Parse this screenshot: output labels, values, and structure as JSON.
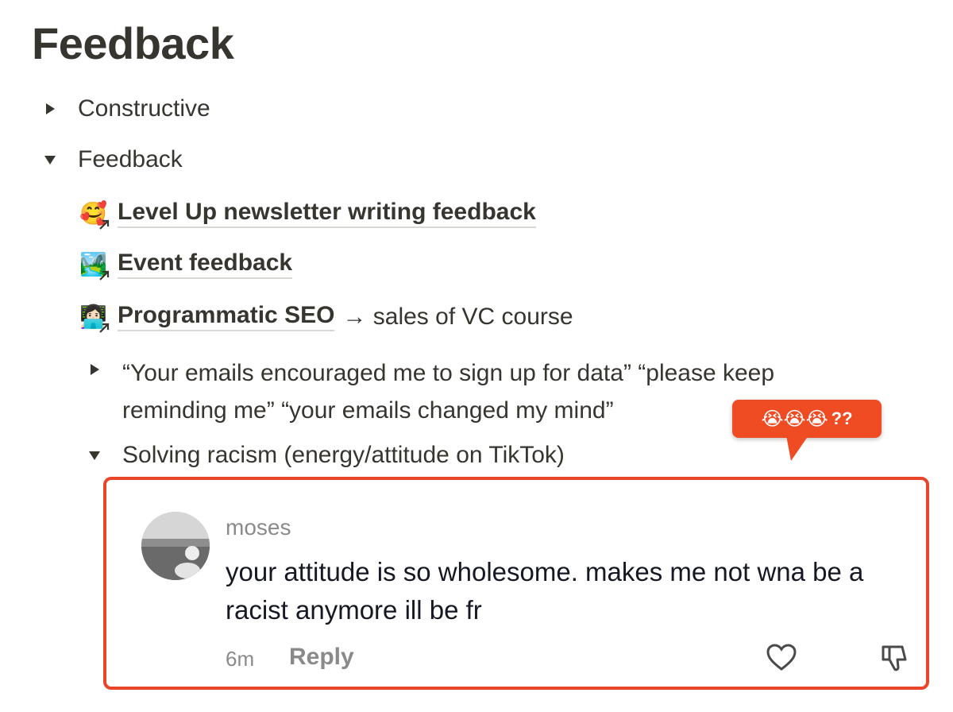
{
  "page": {
    "title": "Feedback"
  },
  "toggles": {
    "constructive": {
      "label": "Constructive",
      "expanded": false
    },
    "feedback": {
      "label": "Feedback",
      "expanded": true
    }
  },
  "linked_pages": [
    {
      "icon": "🥰",
      "title": "Level Up newsletter writing feedback",
      "suffix": ""
    },
    {
      "icon": "🏞️",
      "title": "Event feedback",
      "suffix": ""
    },
    {
      "icon": "👩🏻‍💻",
      "title": "Programmatic SEO",
      "suffix": "→ sales of VC course"
    }
  ],
  "quote_toggle": {
    "text": "“Your emails encouraged me to sign up for data” “please keep reminding me” “your emails changed my mind”",
    "expanded": false
  },
  "racism_toggle": {
    "label": "Solving racism (energy/attitude on TikTok)",
    "expanded": true
  },
  "callout": {
    "emojis": "😭😭😭",
    "text": "??",
    "color": "#f04c24"
  },
  "comment": {
    "username": "moses",
    "text": "your attitude is so wholesome. makes me not wna be a racist anymore ill be fr",
    "time": "6m",
    "reply_label": "Reply",
    "border_color": "#e8452a"
  }
}
